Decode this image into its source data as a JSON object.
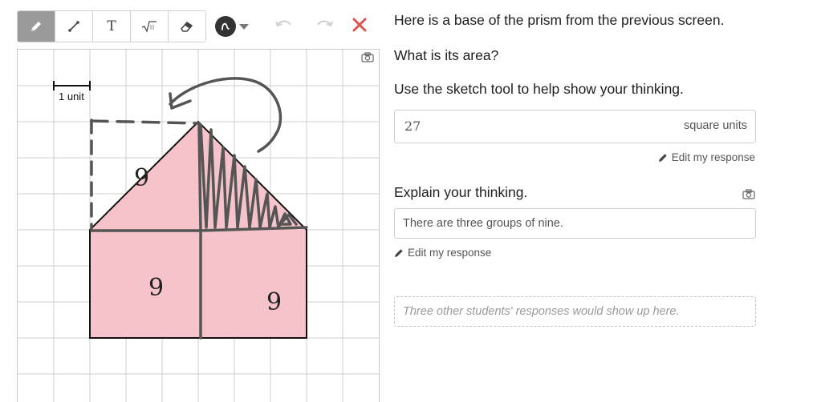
{
  "toolbar": {
    "tools": [
      "pencil-icon",
      "line-icon",
      "text-tool",
      "math-tool",
      "eraser-icon"
    ],
    "text_tool_label": "T",
    "math_tool_label": "√",
    "active_tool": "pencil",
    "ink_color": "#333333",
    "close_color": "#d9534f"
  },
  "canvas": {
    "unit_label": "1 unit",
    "region_labels": [
      "9",
      "9",
      "9"
    ],
    "fill_color": "#f5c3c9"
  },
  "question": {
    "line1": "Here is a base of the prism from the previous screen.",
    "line2": "What is its area?",
    "line3": "Use the sketch tool to help show your thinking."
  },
  "answer": {
    "value": "27",
    "unit": "square units",
    "edit_label": "Edit my response"
  },
  "explain": {
    "prompt": "Explain your thinking.",
    "value": "There are three groups of nine.",
    "edit_label": "Edit my response"
  },
  "others": {
    "placeholder": "Three other students' responses would show up here."
  }
}
